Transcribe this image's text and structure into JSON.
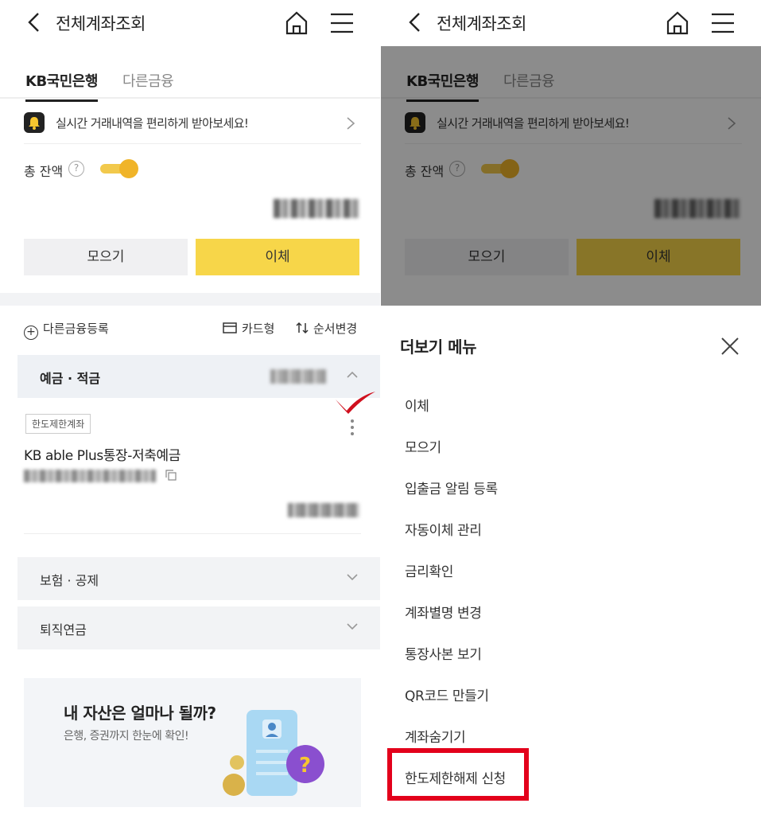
{
  "header": {
    "title": "전체계좌조회"
  },
  "tabs": [
    {
      "label": "KB국민은행"
    },
    {
      "label": "다른금융"
    }
  ],
  "notice": {
    "text": "실시간 거래내역을 편리하게 받아보세요!"
  },
  "balance": {
    "label": "총 잔액",
    "help": "?",
    "toggle_on": true
  },
  "buttons": {
    "gather": "모으기",
    "transfer": "이체"
  },
  "toolbar": {
    "add": "다른금융등록",
    "card": "카드형",
    "order": "순서변경"
  },
  "sections": {
    "deposit": "예금 · 적금",
    "insurance": "보험 · 공제",
    "pension": "퇴직연금"
  },
  "account": {
    "badge": "한도제한계좌",
    "name": "KB able Plus통장-저축예금"
  },
  "promo": {
    "title": "내 자산은 얼마나 될까?",
    "subtitle": "은행, 증권까지 한눈에 확인!"
  },
  "more_menu": {
    "title": "더보기 메뉴",
    "items": [
      "이체",
      "모으기",
      "입출금 알림 등록",
      "자동이체 관리",
      "금리확인",
      "계좌별명 변경",
      "통장사본 보기",
      "QR코드 만들기",
      "계좌숨기기",
      "한도제한해제 신청"
    ]
  },
  "colors": {
    "accent": "#f7d649",
    "toggle": "#f0b429",
    "highlight": "#e3001b",
    "check": "#d0101e"
  }
}
